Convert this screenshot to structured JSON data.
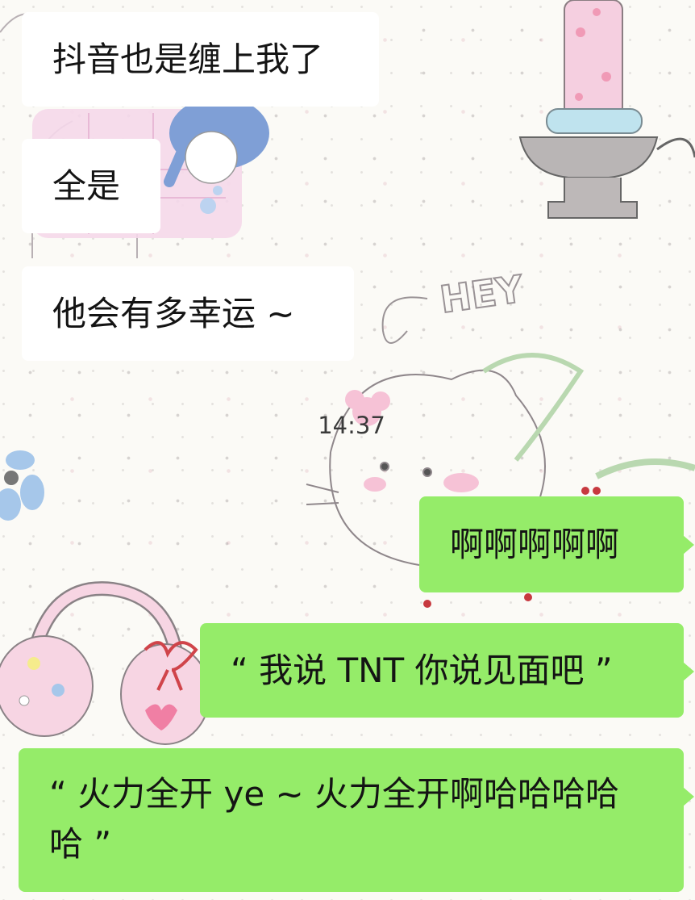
{
  "chat": {
    "incoming": [
      {
        "text": "抖音也是缠上我了"
      },
      {
        "text": "全是"
      },
      {
        "text": "他会有多幸运 ~"
      }
    ],
    "timestamp": "14:37",
    "outgoing": [
      {
        "text": "啊啊啊啊啊"
      },
      {
        "text": "“ 我说 TNT 你说见面吧 ”"
      },
      {
        "text": "“ 火力全开 ye ~ 火力全开啊哈哈哈哈哈 ”"
      }
    ]
  },
  "wallpaper": {
    "doodle_text": "HEY",
    "colors": {
      "outgoing_bubble": "#95ec69",
      "incoming_bubble": "#ffffff",
      "background": "#fbfaf6"
    }
  }
}
